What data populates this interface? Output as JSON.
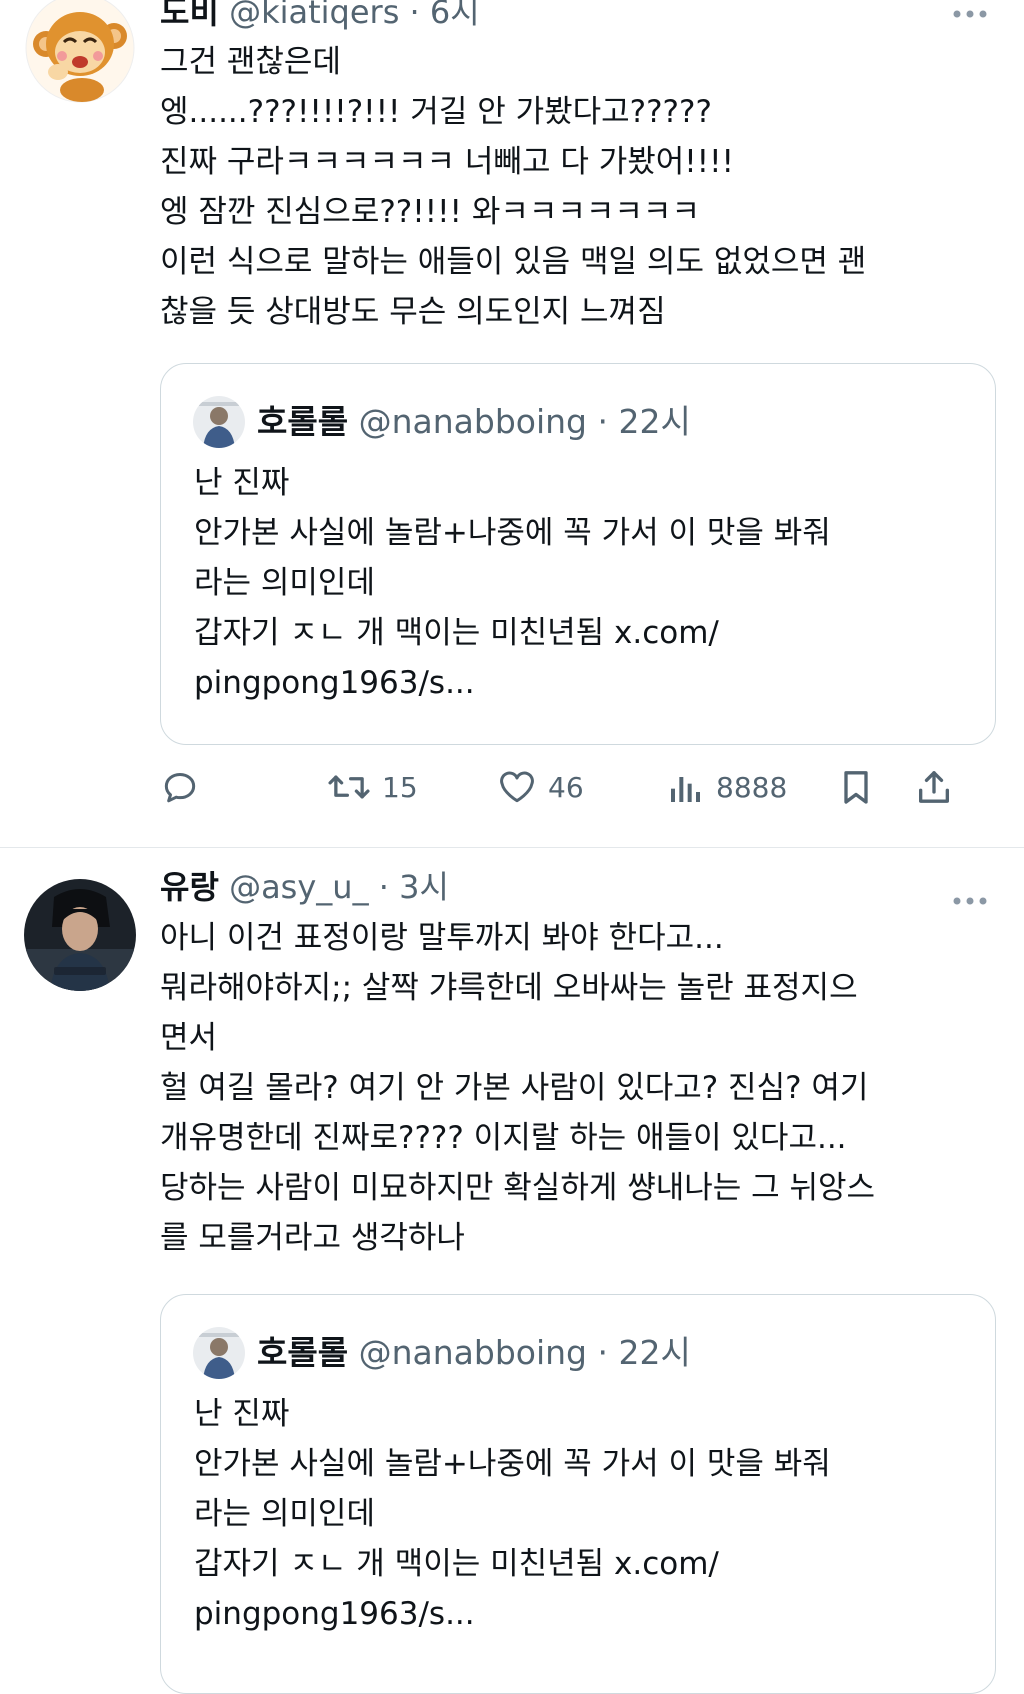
{
  "tweets": [
    {
      "author": {
        "display_name": "도비",
        "handle": "@kiatiqers",
        "time": "6시",
        "avatar_icon": "monkey-avatar"
      },
      "text_lines": [
        "그건 괜찮은데",
        "엥......???!!!!?!!! 거길 안 가봤다고?????",
        "진짜 구라ㅋㅋㅋㅋㅋㅋ 너빼고 다 가봤어!!!!",
        "엥 잠깐 진심으로??!!!! 와ㅋㅋㅋㅋㅋㅋㅋ",
        "이런 식으로 말하는 애들이 있음 맥일 의도 없었으면 괜",
        "찮을 듯 상대방도 무슨 의도인지 느껴짐"
      ],
      "quote": {
        "display_name": "호롤롤",
        "handle": "@nanabboing",
        "time": "22시",
        "text_lines": [
          "난 진짜",
          "안가본 사실에 놀람+나중에 꼭 가서 이 맛을 봐줘",
          "라는 의미인데",
          "갑자기 ㅈㄴ 개 맥이는 미친년됨 x.com/",
          "pingpong1963/s..."
        ]
      },
      "actions": {
        "reply_icon": "reply-icon",
        "retweet_count": "15",
        "like_count": "46",
        "view_count": "8888",
        "bookmark_icon": "bookmark-icon",
        "share_icon": "share-icon"
      }
    },
    {
      "author": {
        "display_name": "유랑",
        "handle": "@asy_u_",
        "time": "3시",
        "avatar_icon": "portrait-avatar"
      },
      "text_lines": [
        "아니 이건 표정이랑 말투까지 봐야 한다고...",
        "뭐라해야하지;; 살짝 갸륵한데 오바싸는 놀란 표정지으",
        "면서",
        "헐 여길 몰라? 여기 안 가본 사람이 있다고? 진심? 여기",
        "개유명한데 진짜로???? 이지랄 하는 애들이 있다고...",
        "당하는 사람이 미묘하지만 확실하게 썅내나는 그 뉘앙스",
        "를 모를거라고 생각하나"
      ],
      "quote": {
        "display_name": "호롤롤",
        "handle": "@nanabboing",
        "time": "22시",
        "text_lines": [
          "난 진짜",
          "안가본 사실에 놀람+나중에 꼭 가서 이 맛을 봐줘",
          "라는 의미인데",
          "갑자기 ㅈㄴ 개 맥이는 미친년됨 x.com/",
          "pingpong1963/s..."
        ]
      }
    }
  ],
  "colors": {
    "text_primary": "#0f1419",
    "text_secondary": "#536471",
    "border": "#cfd9de",
    "divider": "#e4e8eb"
  }
}
